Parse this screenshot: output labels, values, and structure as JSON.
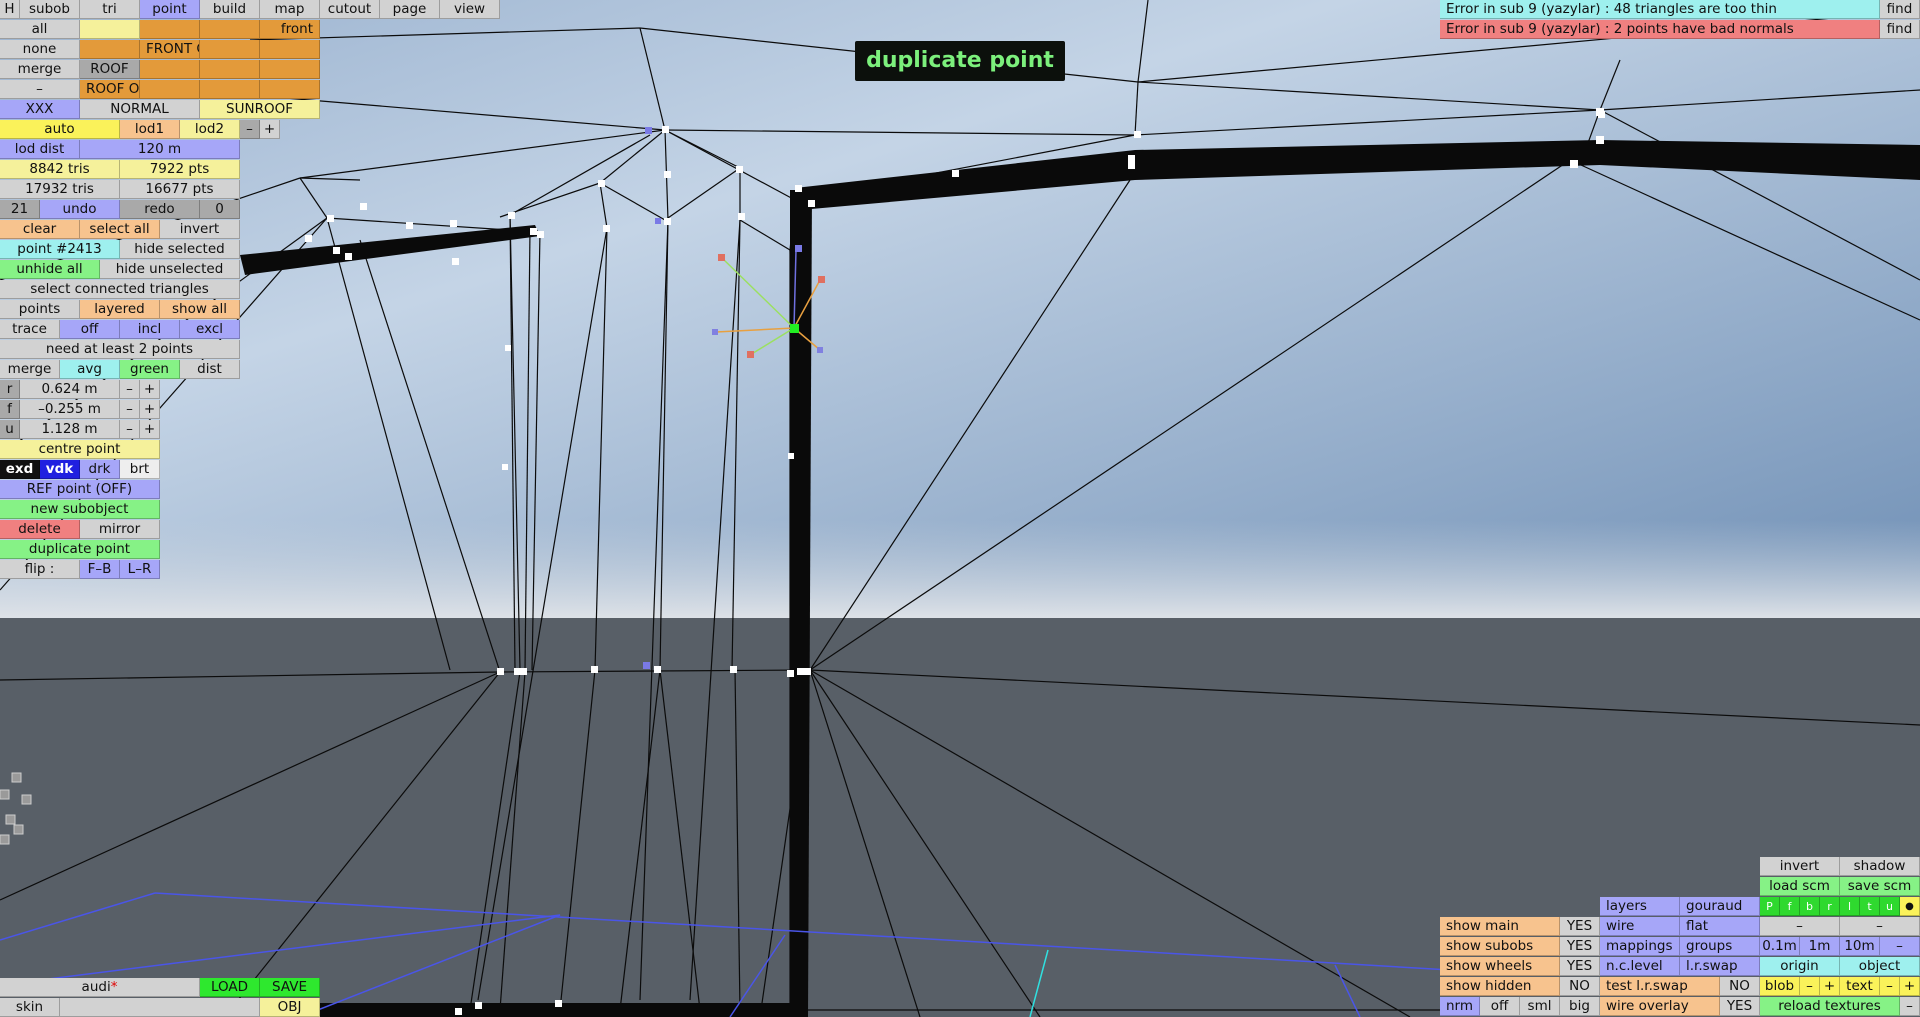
{
  "toast": "duplicate point",
  "top_tabs": [
    "H",
    "subob",
    "tri",
    "point",
    "build",
    "map",
    "cutout",
    "page",
    "view"
  ],
  "grid": {
    "all": "all",
    "none": "none",
    "merge": "merge",
    "dash": "–",
    "front": "front",
    "front_g": "FRONT G",
    "roof": "ROOF",
    "roof_op": "ROOF OP"
  },
  "groups_row": [
    "XXX",
    "NORMAL",
    "SUNROOF"
  ],
  "lod": {
    "auto": "auto",
    "lod1": "lod1",
    "lod2": "lod2",
    "minus": "–",
    "plus": "+",
    "dist_label": "lod dist",
    "dist_value": "120 m"
  },
  "stats": {
    "tris1": "8842 tris",
    "pts1": "7922 pts",
    "tris2": "17932 tris",
    "pts2": "16677 pts"
  },
  "history": {
    "count": "21",
    "undo": "undo",
    "redo": "redo",
    "redo_count": "0"
  },
  "sel": {
    "clear": "clear",
    "select_all": "select all",
    "invert": "invert",
    "point_id": "point #2413",
    "hide_selected": "hide selected",
    "unhide_all": "unhide all",
    "hide_unselected": "hide unselected",
    "select_connected": "select connected triangles"
  },
  "pts_row": [
    "points",
    "layered",
    "show all"
  ],
  "trace_row": [
    "trace",
    "off",
    "incl",
    "excl"
  ],
  "need": "need at least 2 points",
  "merge_row": [
    "merge",
    "avg",
    "green",
    "dist"
  ],
  "coords": [
    {
      "axis": "r",
      "value": "0.624 m"
    },
    {
      "axis": "f",
      "value": "–0.255 m"
    },
    {
      "axis": "u",
      "value": "1.128 m"
    }
  ],
  "centre": "centre point",
  "view_modes": [
    "exd",
    "vdk",
    "drk",
    "brt"
  ],
  "ref": "REF point (OFF)",
  "new_subobject": "new subobject",
  "delete": "delete",
  "mirror": "mirror",
  "dup": "duplicate point",
  "flip": {
    "label": "flip :",
    "fb": "F–B",
    "lr": "L–R"
  },
  "errors": [
    {
      "text": "Error in sub 9 (yazylar) : 48 triangles are too thin",
      "find": "find",
      "color": "#9ef0ee"
    },
    {
      "text": "Error in sub 9 (yazylar) : 2 points have bad normals",
      "find": "find",
      "color": "#f08080"
    }
  ],
  "bottom_left": {
    "name": "audi",
    "star": "*",
    "load": "LOAD",
    "save": "SAVE",
    "skin": "skin",
    "obj": "OBJ"
  },
  "br": {
    "invert": "invert",
    "shadow": "shadow",
    "load_scm": "load scm",
    "save_scm": "save scm",
    "layers": "layers",
    "gouraud": "gouraud",
    "letters": [
      "P",
      "f",
      "b",
      "r",
      "l",
      "t",
      "u"
    ],
    "dot": "●",
    "show_main": "show main",
    "show_subobs": "show subobs",
    "show_wheels": "show wheels",
    "show_hidden": "show hidden",
    "yes": "YES",
    "no": "NO",
    "wire": "wire",
    "flat": "flat",
    "mappings": "mappings",
    "groups": "groups",
    "nc_level": "n.c.level",
    "lr_swap": "l.r.swap",
    "test_lr_swap": "test l.r.swap",
    "wire_overlay": "wire overlay",
    "dash": "–",
    "d01": "0.1m",
    "d1": "1m",
    "d10": "10m",
    "origin": "origin",
    "object": "object",
    "blob": "blob",
    "text": "text",
    "minus": "–",
    "plus": "+",
    "nrm": "nrm",
    "off": "off",
    "sml": "sml",
    "big": "big",
    "reload": "reload textures"
  }
}
